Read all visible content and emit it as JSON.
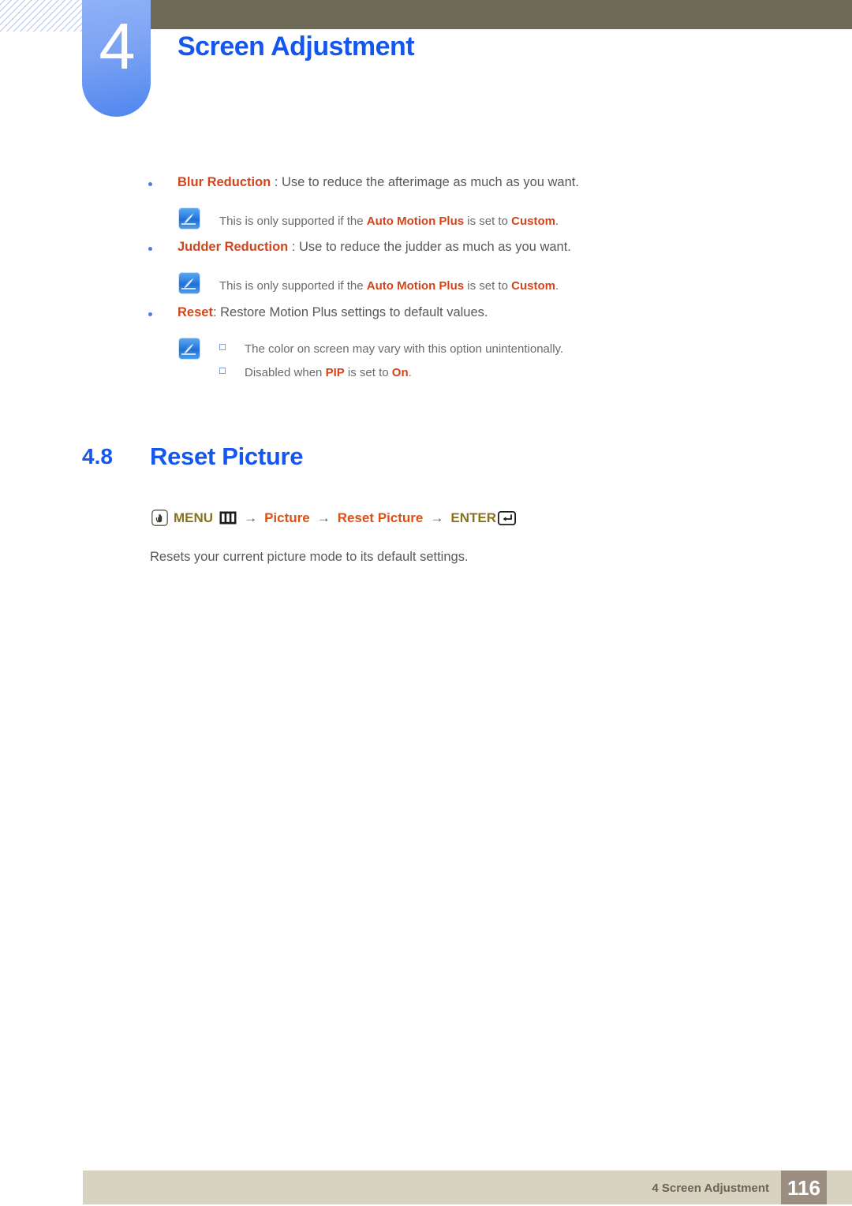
{
  "header": {
    "chapter_number": "4",
    "chapter_title": "Screen Adjustment",
    "accent_blue": "#1456f0",
    "olive": "#6d6b58"
  },
  "content": {
    "bullets": [
      {
        "keyword": "Blur Reduction",
        "rest": " : Use to reduce the afterimage as much as you want.",
        "note": {
          "icon": "note-pen-icon",
          "lines": [
            {
              "parts": [
                {
                  "t": "This is only supported if the ",
                  "kw": false
                },
                {
                  "t": "Auto Motion Plus",
                  "kw": true
                },
                {
                  "t": " is set to ",
                  "kw": false
                },
                {
                  "t": "Custom",
                  "kw": true
                },
                {
                  "t": ".",
                  "kw": false
                }
              ]
            }
          ]
        }
      },
      {
        "keyword": "Judder Reduction",
        "rest": " : Use to reduce the judder as much as you want.",
        "note": {
          "icon": "note-pen-icon",
          "lines": [
            {
              "parts": [
                {
                  "t": "This is only supported if the ",
                  "kw": false
                },
                {
                  "t": "Auto Motion Plus",
                  "kw": true
                },
                {
                  "t": " is set to ",
                  "kw": false
                },
                {
                  "t": "Custom",
                  "kw": true
                },
                {
                  "t": ".",
                  "kw": false
                }
              ]
            }
          ]
        }
      },
      {
        "keyword": "Reset",
        "rest": ": Restore Motion Plus settings to default values.",
        "note": {
          "icon": "note-pen-icon",
          "lines": [
            {
              "square": true,
              "parts": [
                {
                  "t": "The color on screen may vary with this option unintentionally.",
                  "kw": false
                }
              ]
            },
            {
              "square": true,
              "parts": [
                {
                  "t": "Disabled when ",
                  "kw": false
                },
                {
                  "t": "PIP",
                  "kw": true
                },
                {
                  "t": " is set to ",
                  "kw": false
                },
                {
                  "t": "On",
                  "kw": true
                },
                {
                  "t": ".",
                  "kw": false
                }
              ]
            }
          ]
        }
      }
    ],
    "section": {
      "number": "4.8",
      "title": "Reset Picture"
    },
    "menu_path": {
      "hand_icon": "hand-press-icon",
      "menu_label": "MENU",
      "menu_icon": "menu-bars-icon",
      "arrow": "→",
      "step1": "Picture",
      "step2": "Reset Picture",
      "enter_label": "ENTER",
      "enter_icon": "enter-return-icon",
      "gold_color": "#8a7320",
      "orange_color": "#e24f10"
    },
    "description": "Resets your current picture mode to its default settings."
  },
  "footer": {
    "label": "4 Screen Adjustment",
    "page": "116",
    "bar_color": "#d8d3c0",
    "page_box_color": "#9b8d80"
  }
}
